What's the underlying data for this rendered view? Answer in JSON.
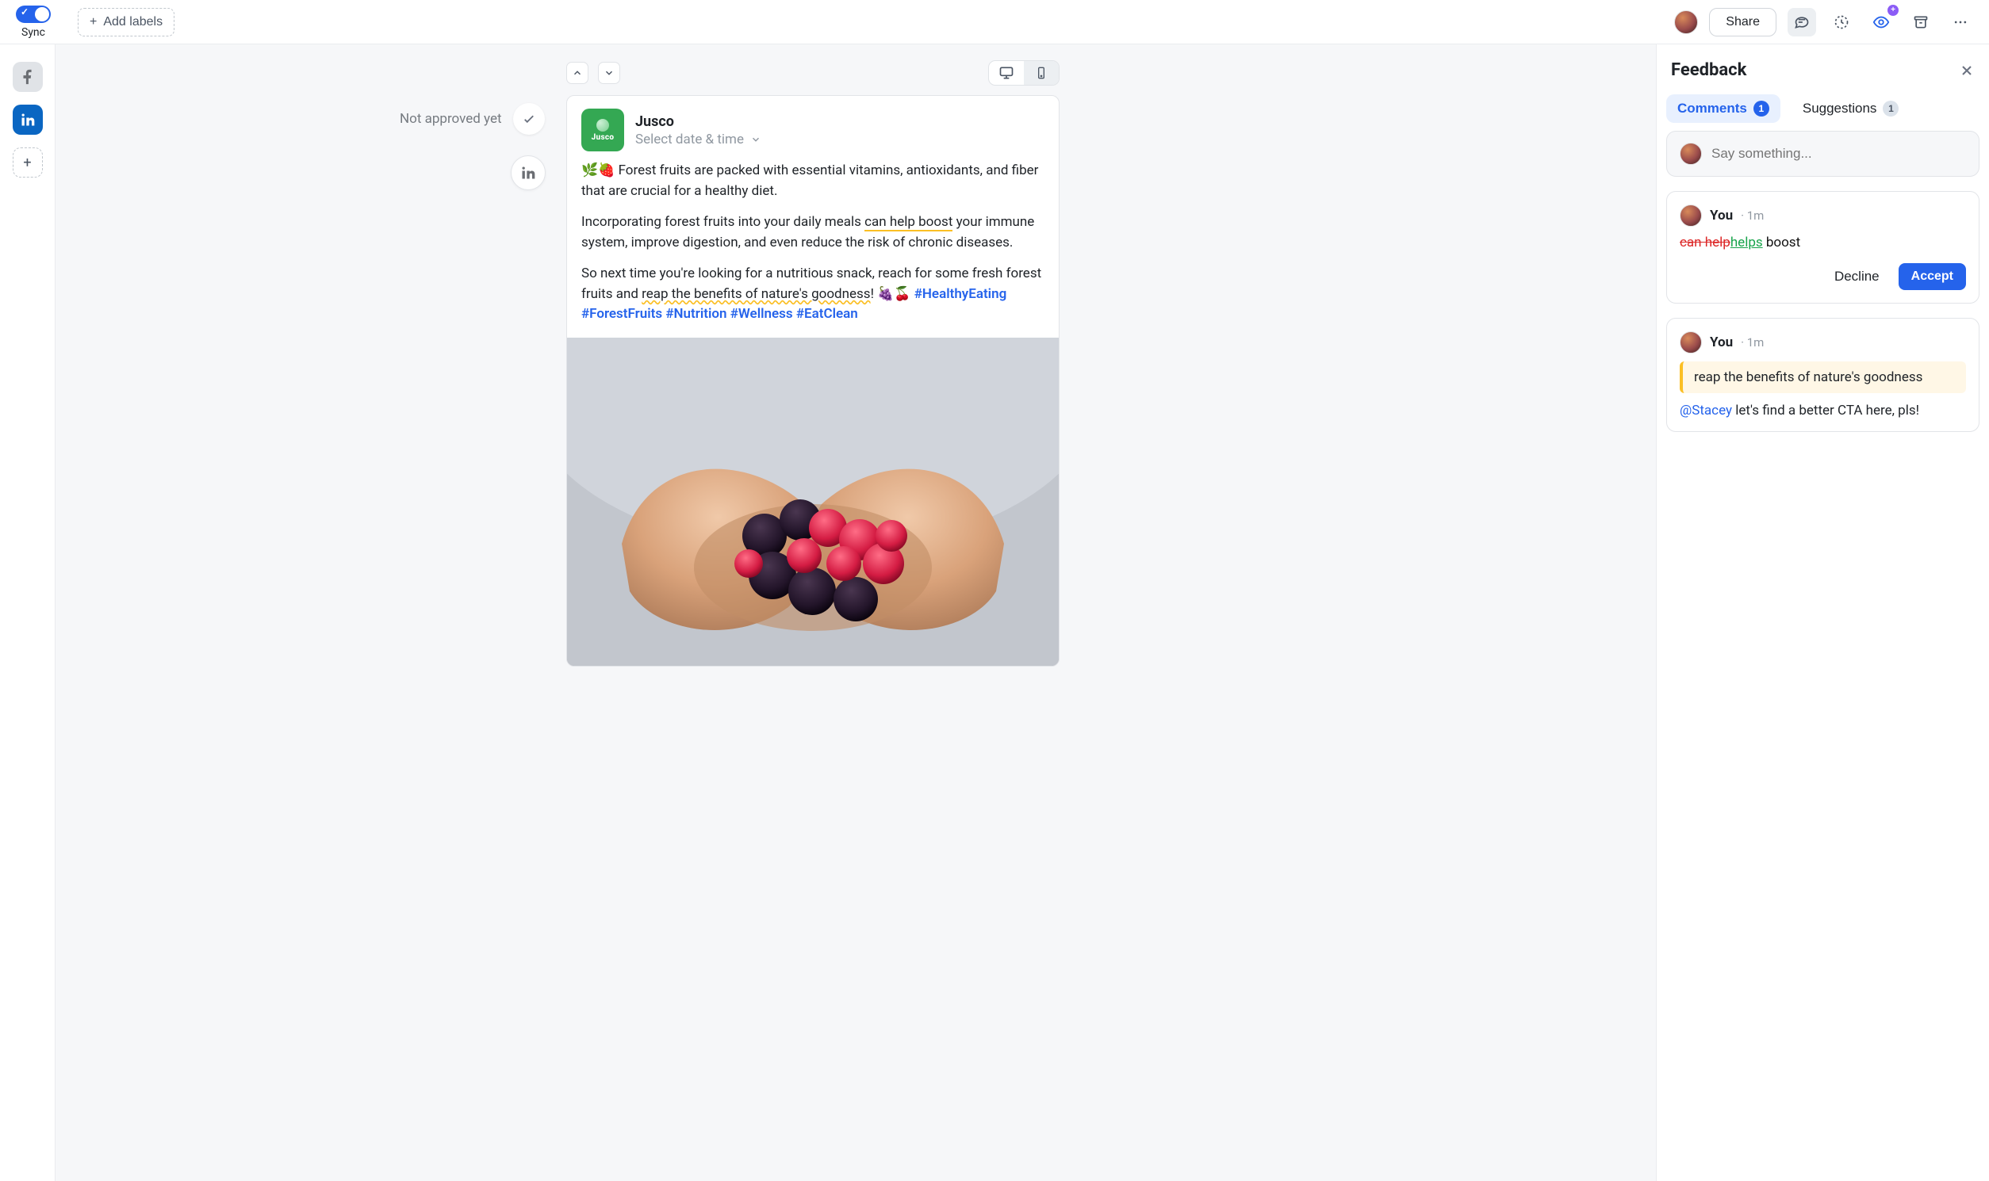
{
  "topbar": {
    "sync_label": "Sync",
    "add_labels": "Add labels",
    "share": "Share"
  },
  "leftrail": {
    "add_tooltip": "+"
  },
  "approval": {
    "status": "Not approved yet"
  },
  "post": {
    "brand": "Jusco",
    "date_placeholder": "Select date & time",
    "emoji_lead": "🌿🍓",
    "para1": "Forest fruits are packed with essential vitamins, antioxidants, and fiber that are crucial for a healthy diet.",
    "para2_before": "Incorporating forest fruits into your daily meals ",
    "para2_highlight": "can help boost",
    "para2_after": " your immune system, improve digestion, and even reduce the risk of chronic diseases.",
    "para3_before": "So next time you're looking for a nutritious snack, reach for some fresh forest fruits and ",
    "para3_highlight": "reap the benefits of nature's goodness",
    "para3_after": "! 🍇🍒 ",
    "hashtags": "#HealthyEating #ForestFruits #Nutrition #Wellness #EatClean"
  },
  "feedback": {
    "title": "Feedback",
    "tabs": {
      "comments_label": "Comments",
      "comments_count": "1",
      "suggestions_label": "Suggestions",
      "suggestions_count": "1"
    },
    "say_placeholder": "Say something...",
    "c1": {
      "author": "You",
      "meta": "· 1m",
      "strike": "can help",
      "insert": "helps",
      "rest": " boost",
      "decline": "Decline",
      "accept": "Accept"
    },
    "c2": {
      "author": "You",
      "meta": "· 1m",
      "quote": "reap the benefits of nature's goodness",
      "mention": "@Stacey",
      "body_rest": " let's find a better CTA here, pls!"
    }
  }
}
